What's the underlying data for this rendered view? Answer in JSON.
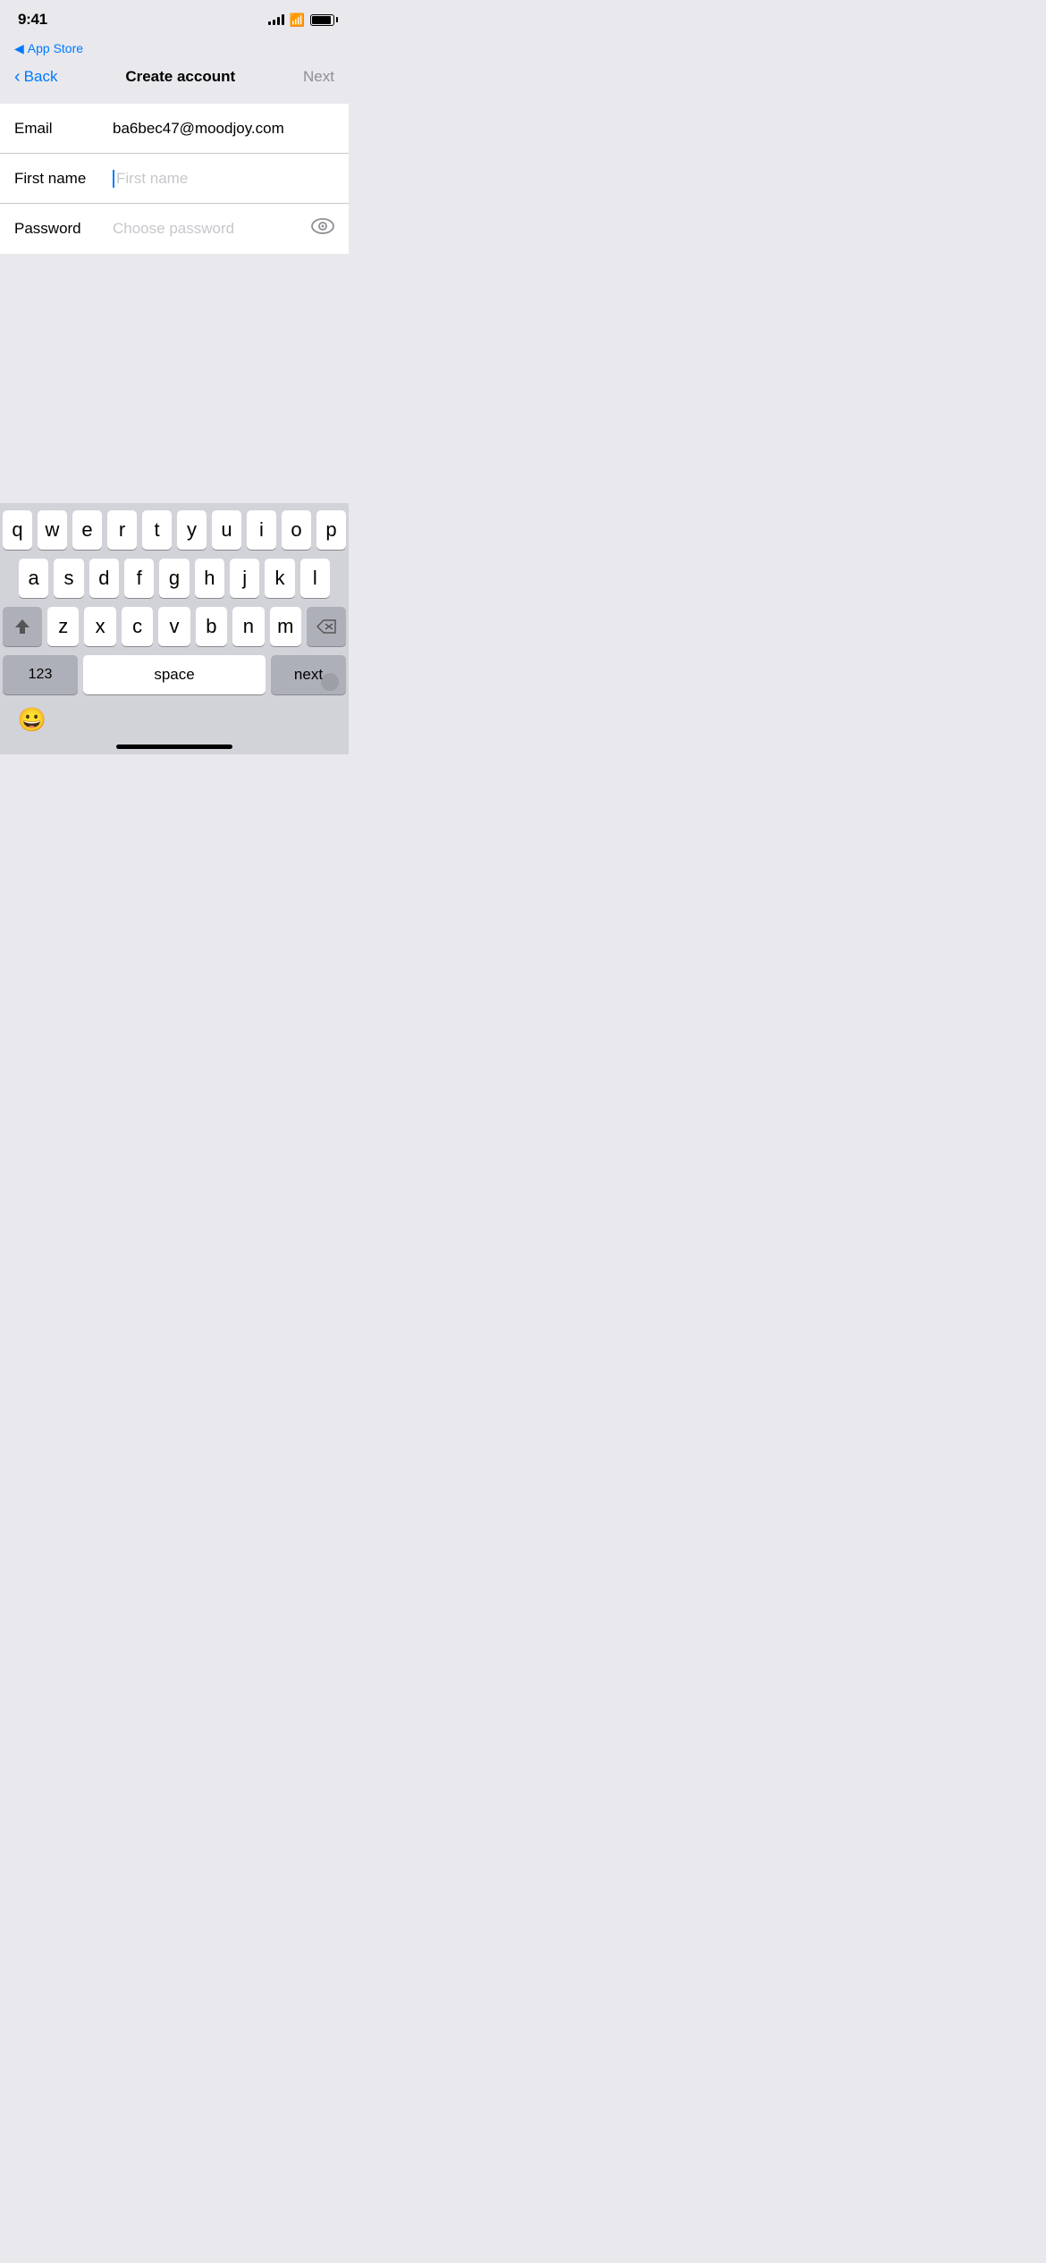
{
  "statusBar": {
    "time": "9:41",
    "appStoreLabel": "App Store"
  },
  "nav": {
    "backLabel": "Back",
    "title": "Create account",
    "nextLabel": "Next"
  },
  "form": {
    "emailLabel": "Email",
    "emailValue": "ba6bec47@moodjoy.com",
    "firstNameLabel": "First name",
    "firstNamePlaceholder": "First name",
    "passwordLabel": "Password",
    "passwordPlaceholder": "Choose password"
  },
  "keyboard": {
    "row1": [
      "q",
      "w",
      "e",
      "r",
      "t",
      "y",
      "u",
      "i",
      "o",
      "p"
    ],
    "row2": [
      "a",
      "s",
      "d",
      "f",
      "g",
      "h",
      "j",
      "k",
      "l"
    ],
    "row3": [
      "z",
      "x",
      "c",
      "v",
      "b",
      "n",
      "m"
    ],
    "numLabel": "123",
    "spaceLabel": "space",
    "nextLabel": "next"
  }
}
